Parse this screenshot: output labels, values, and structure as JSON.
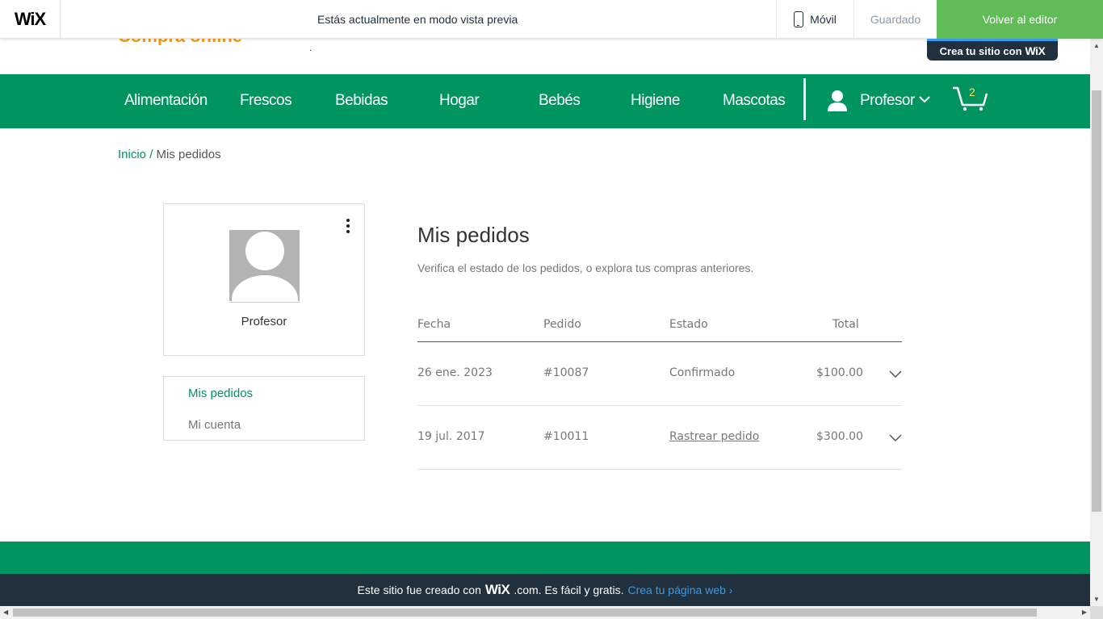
{
  "wix_bar": {
    "logo": "WiX",
    "preview_message": "Estás actualmente en modo vista previa",
    "mobile_label": "Móvil",
    "saved_label": "Guardado",
    "back_label": "Volver al editor"
  },
  "site": {
    "brand": "Compra online",
    "brand_dot": ".",
    "crea_badge_text": "Crea tu sitio con",
    "crea_badge_logo": "WiX"
  },
  "nav": {
    "items": [
      "Alimentación",
      "Frescos",
      "Bebidas",
      "Hogar",
      "Bebés",
      "Higiene",
      "Mascotas"
    ],
    "user_name": "Profesor",
    "cart_count": "2"
  },
  "breadcrumb": {
    "home": "Inicio",
    "separator": "/",
    "current": "Mis pedidos"
  },
  "profile": {
    "name": "Profesor"
  },
  "side_menu": {
    "items": [
      "Mis pedidos",
      "Mi cuenta"
    ]
  },
  "orders": {
    "title": "Mis pedidos",
    "subtitle": "Verifica el estado de los pedidos, o explora tus compras anteriores.",
    "columns": [
      "Fecha",
      "Pedido",
      "Estado",
      "Total"
    ],
    "rows": [
      {
        "date": "26 ene. 2023",
        "order": "#10087",
        "status": "Confirmado",
        "total": "$100.00"
      },
      {
        "date": "19 jul. 2017",
        "order": "#10011",
        "status": "Rastrear pedido",
        "total": "$300.00"
      }
    ]
  },
  "footer": {
    "text_before": "Este sitio fue creado con",
    "logo": "WiX",
    "text_after": ".com. Es fácil y gratis.",
    "cta": "Crea tu página web ›"
  },
  "colors": {
    "brand_green": "#009460",
    "wix_green": "#60bc57",
    "wix_dark": "#20303c",
    "wix_blue": "#3899ec",
    "brand_orange": "#f39c12"
  }
}
